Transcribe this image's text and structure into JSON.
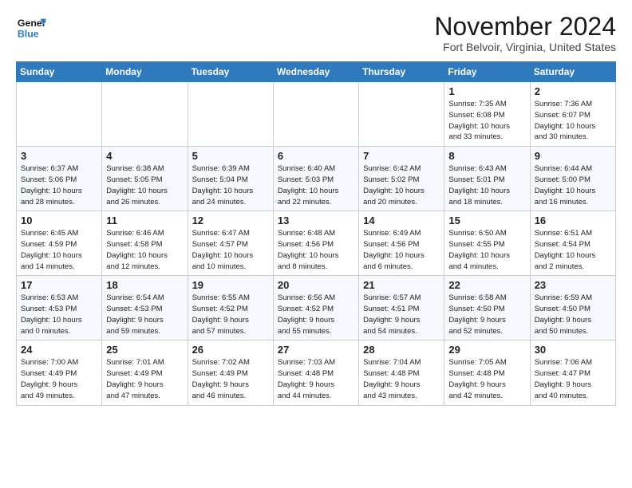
{
  "logo": {
    "line1": "General",
    "line2": "Blue"
  },
  "title": "November 2024",
  "location": "Fort Belvoir, Virginia, United States",
  "header_days": [
    "Sunday",
    "Monday",
    "Tuesday",
    "Wednesday",
    "Thursday",
    "Friday",
    "Saturday"
  ],
  "weeks": [
    [
      {
        "day": "",
        "info": ""
      },
      {
        "day": "",
        "info": ""
      },
      {
        "day": "",
        "info": ""
      },
      {
        "day": "",
        "info": ""
      },
      {
        "day": "",
        "info": ""
      },
      {
        "day": "1",
        "info": "Sunrise: 7:35 AM\nSunset: 6:08 PM\nDaylight: 10 hours\nand 33 minutes."
      },
      {
        "day": "2",
        "info": "Sunrise: 7:36 AM\nSunset: 6:07 PM\nDaylight: 10 hours\nand 30 minutes."
      }
    ],
    [
      {
        "day": "3",
        "info": "Sunrise: 6:37 AM\nSunset: 5:06 PM\nDaylight: 10 hours\nand 28 minutes."
      },
      {
        "day": "4",
        "info": "Sunrise: 6:38 AM\nSunset: 5:05 PM\nDaylight: 10 hours\nand 26 minutes."
      },
      {
        "day": "5",
        "info": "Sunrise: 6:39 AM\nSunset: 5:04 PM\nDaylight: 10 hours\nand 24 minutes."
      },
      {
        "day": "6",
        "info": "Sunrise: 6:40 AM\nSunset: 5:03 PM\nDaylight: 10 hours\nand 22 minutes."
      },
      {
        "day": "7",
        "info": "Sunrise: 6:42 AM\nSunset: 5:02 PM\nDaylight: 10 hours\nand 20 minutes."
      },
      {
        "day": "8",
        "info": "Sunrise: 6:43 AM\nSunset: 5:01 PM\nDaylight: 10 hours\nand 18 minutes."
      },
      {
        "day": "9",
        "info": "Sunrise: 6:44 AM\nSunset: 5:00 PM\nDaylight: 10 hours\nand 16 minutes."
      }
    ],
    [
      {
        "day": "10",
        "info": "Sunrise: 6:45 AM\nSunset: 4:59 PM\nDaylight: 10 hours\nand 14 minutes."
      },
      {
        "day": "11",
        "info": "Sunrise: 6:46 AM\nSunset: 4:58 PM\nDaylight: 10 hours\nand 12 minutes."
      },
      {
        "day": "12",
        "info": "Sunrise: 6:47 AM\nSunset: 4:57 PM\nDaylight: 10 hours\nand 10 minutes."
      },
      {
        "day": "13",
        "info": "Sunrise: 6:48 AM\nSunset: 4:56 PM\nDaylight: 10 hours\nand 8 minutes."
      },
      {
        "day": "14",
        "info": "Sunrise: 6:49 AM\nSunset: 4:56 PM\nDaylight: 10 hours\nand 6 minutes."
      },
      {
        "day": "15",
        "info": "Sunrise: 6:50 AM\nSunset: 4:55 PM\nDaylight: 10 hours\nand 4 minutes."
      },
      {
        "day": "16",
        "info": "Sunrise: 6:51 AM\nSunset: 4:54 PM\nDaylight: 10 hours\nand 2 minutes."
      }
    ],
    [
      {
        "day": "17",
        "info": "Sunrise: 6:53 AM\nSunset: 4:53 PM\nDaylight: 10 hours\nand 0 minutes."
      },
      {
        "day": "18",
        "info": "Sunrise: 6:54 AM\nSunset: 4:53 PM\nDaylight: 9 hours\nand 59 minutes."
      },
      {
        "day": "19",
        "info": "Sunrise: 6:55 AM\nSunset: 4:52 PM\nDaylight: 9 hours\nand 57 minutes."
      },
      {
        "day": "20",
        "info": "Sunrise: 6:56 AM\nSunset: 4:52 PM\nDaylight: 9 hours\nand 55 minutes."
      },
      {
        "day": "21",
        "info": "Sunrise: 6:57 AM\nSunset: 4:51 PM\nDaylight: 9 hours\nand 54 minutes."
      },
      {
        "day": "22",
        "info": "Sunrise: 6:58 AM\nSunset: 4:50 PM\nDaylight: 9 hours\nand 52 minutes."
      },
      {
        "day": "23",
        "info": "Sunrise: 6:59 AM\nSunset: 4:50 PM\nDaylight: 9 hours\nand 50 minutes."
      }
    ],
    [
      {
        "day": "24",
        "info": "Sunrise: 7:00 AM\nSunset: 4:49 PM\nDaylight: 9 hours\nand 49 minutes."
      },
      {
        "day": "25",
        "info": "Sunrise: 7:01 AM\nSunset: 4:49 PM\nDaylight: 9 hours\nand 47 minutes."
      },
      {
        "day": "26",
        "info": "Sunrise: 7:02 AM\nSunset: 4:49 PM\nDaylight: 9 hours\nand 46 minutes."
      },
      {
        "day": "27",
        "info": "Sunrise: 7:03 AM\nSunset: 4:48 PM\nDaylight: 9 hours\nand 44 minutes."
      },
      {
        "day": "28",
        "info": "Sunrise: 7:04 AM\nSunset: 4:48 PM\nDaylight: 9 hours\nand 43 minutes."
      },
      {
        "day": "29",
        "info": "Sunrise: 7:05 AM\nSunset: 4:48 PM\nDaylight: 9 hours\nand 42 minutes."
      },
      {
        "day": "30",
        "info": "Sunrise: 7:06 AM\nSunset: 4:47 PM\nDaylight: 9 hours\nand 40 minutes."
      }
    ]
  ]
}
